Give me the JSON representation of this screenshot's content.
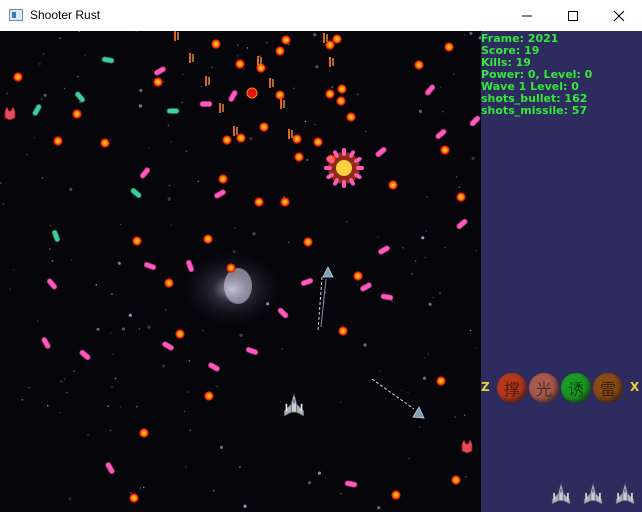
{
  "window": {
    "title": "Shooter Rust",
    "minimize_icon": "minimize-icon",
    "maximize_icon": "maximize-icon",
    "close_icon": "close-icon"
  },
  "hud": {
    "stats": [
      {
        "label": "Frame",
        "value": "2021"
      },
      {
        "label": "Score",
        "value": "19"
      },
      {
        "label": "Kills",
        "value": "19"
      },
      {
        "label": "Power",
        "value": "0, Level: 0"
      },
      {
        "label": "Wave",
        "value": "1 Level: 0",
        "sep": " "
      },
      {
        "label": "shots_bullet",
        "value": "162"
      },
      {
        "label": "shots_missile",
        "value": "57"
      }
    ],
    "hotkey_left": "Z",
    "hotkey_right": "X",
    "skills": [
      {
        "glyph": "撑",
        "color": "#b5381c",
        "icon": "skill-red-icon"
      },
      {
        "glyph": "光",
        "color": "#a85a4e",
        "icon": "skill-rose-icon"
      },
      {
        "glyph": "诱",
        "color": "#1a9a22",
        "icon": "skill-green-icon"
      },
      {
        "glyph": "雷",
        "color": "#8a4a16",
        "icon": "skill-brown-icon"
      }
    ],
    "lives": 3,
    "life_icon": "player-ship-icon"
  },
  "colors": {
    "hud_text": "#33e83b",
    "hud_bg": "#2e2b5e",
    "bullet_orange": "#ff8a00",
    "bullet_red": "#e81414",
    "enemy_pink": "#ff5ab9",
    "enemy_teal": "#3ecf9a"
  }
}
